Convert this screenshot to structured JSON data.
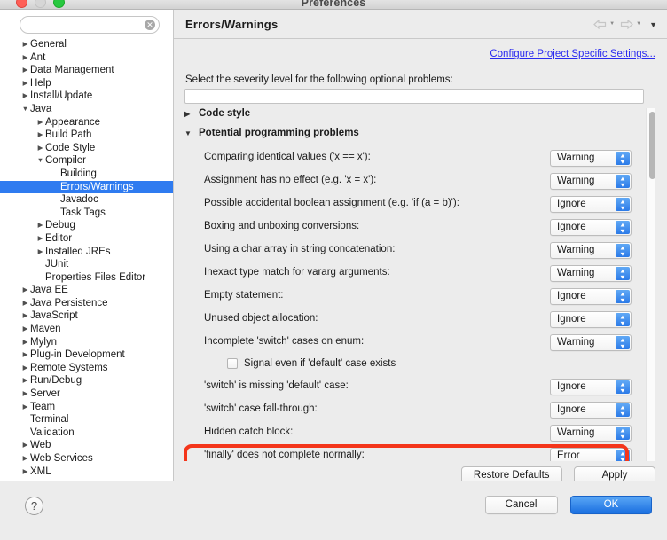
{
  "window": {
    "title": "Preferences",
    "traffic_lights": [
      "close",
      "minimize",
      "zoom"
    ]
  },
  "sidebar": {
    "search": {
      "value": "",
      "placeholder": ""
    },
    "clear_icon": "clear-icon",
    "items": [
      {
        "label": "General",
        "depth": 0,
        "twisty": "right",
        "selected": false
      },
      {
        "label": "Ant",
        "depth": 0,
        "twisty": "right",
        "selected": false
      },
      {
        "label": "Data Management",
        "depth": 0,
        "twisty": "right",
        "selected": false
      },
      {
        "label": "Help",
        "depth": 0,
        "twisty": "right",
        "selected": false
      },
      {
        "label": "Install/Update",
        "depth": 0,
        "twisty": "right",
        "selected": false
      },
      {
        "label": "Java",
        "depth": 0,
        "twisty": "down",
        "selected": false
      },
      {
        "label": "Appearance",
        "depth": 1,
        "twisty": "right",
        "selected": false
      },
      {
        "label": "Build Path",
        "depth": 1,
        "twisty": "right",
        "selected": false
      },
      {
        "label": "Code Style",
        "depth": 1,
        "twisty": "right",
        "selected": false
      },
      {
        "label": "Compiler",
        "depth": 1,
        "twisty": "down",
        "selected": false
      },
      {
        "label": "Building",
        "depth": 2,
        "twisty": "none",
        "selected": false
      },
      {
        "label": "Errors/Warnings",
        "depth": 2,
        "twisty": "none",
        "selected": true
      },
      {
        "label": "Javadoc",
        "depth": 2,
        "twisty": "none",
        "selected": false
      },
      {
        "label": "Task Tags",
        "depth": 2,
        "twisty": "none",
        "selected": false
      },
      {
        "label": "Debug",
        "depth": 1,
        "twisty": "right",
        "selected": false
      },
      {
        "label": "Editor",
        "depth": 1,
        "twisty": "right",
        "selected": false
      },
      {
        "label": "Installed JREs",
        "depth": 1,
        "twisty": "right",
        "selected": false
      },
      {
        "label": "JUnit",
        "depth": 1,
        "twisty": "none",
        "selected": false
      },
      {
        "label": "Properties Files Editor",
        "depth": 1,
        "twisty": "none",
        "selected": false
      },
      {
        "label": "Java EE",
        "depth": 0,
        "twisty": "right",
        "selected": false
      },
      {
        "label": "Java Persistence",
        "depth": 0,
        "twisty": "right",
        "selected": false
      },
      {
        "label": "JavaScript",
        "depth": 0,
        "twisty": "right",
        "selected": false
      },
      {
        "label": "Maven",
        "depth": 0,
        "twisty": "right",
        "selected": false
      },
      {
        "label": "Mylyn",
        "depth": 0,
        "twisty": "right",
        "selected": false
      },
      {
        "label": "Plug-in Development",
        "depth": 0,
        "twisty": "right",
        "selected": false
      },
      {
        "label": "Remote Systems",
        "depth": 0,
        "twisty": "right",
        "selected": false
      },
      {
        "label": "Run/Debug",
        "depth": 0,
        "twisty": "right",
        "selected": false
      },
      {
        "label": "Server",
        "depth": 0,
        "twisty": "right",
        "selected": false
      },
      {
        "label": "Team",
        "depth": 0,
        "twisty": "right",
        "selected": false
      },
      {
        "label": "Terminal",
        "depth": 0,
        "twisty": "none",
        "selected": false
      },
      {
        "label": "Validation",
        "depth": 0,
        "twisty": "none",
        "selected": false
      },
      {
        "label": "Web",
        "depth": 0,
        "twisty": "right",
        "selected": false
      },
      {
        "label": "Web Services",
        "depth": 0,
        "twisty": "right",
        "selected": false
      },
      {
        "label": "XML",
        "depth": 0,
        "twisty": "right",
        "selected": false
      }
    ]
  },
  "panel": {
    "title": "Errors/Warnings",
    "nav": {
      "back_icon": "back-arrow-icon",
      "forward_icon": "forward-arrow-icon",
      "menu_icon": "chevron-down-icon"
    },
    "configure_link": "Configure Project Specific Settings...",
    "severity_label": "Select the severity level for the following optional problems:",
    "filter": {
      "value": "",
      "placeholder": ""
    },
    "groups": [
      {
        "label": "Code style",
        "expanded": false
      },
      {
        "label": "Potential programming problems",
        "expanded": true
      }
    ],
    "options": [
      {
        "label": "Comparing identical values ('x == x'):",
        "value": "Warning",
        "highlighted": false
      },
      {
        "label": "Assignment has no effect (e.g. 'x = x'):",
        "value": "Warning",
        "highlighted": false
      },
      {
        "label": "Possible accidental boolean assignment (e.g. 'if (a = b)'):",
        "value": "Ignore",
        "highlighted": false
      },
      {
        "label": "Boxing and unboxing conversions:",
        "value": "Ignore",
        "highlighted": false
      },
      {
        "label": "Using a char array in string concatenation:",
        "value": "Warning",
        "highlighted": false
      },
      {
        "label": "Inexact type match for vararg arguments:",
        "value": "Warning",
        "highlighted": false
      },
      {
        "label": "Empty statement:",
        "value": "Ignore",
        "highlighted": false
      },
      {
        "label": "Unused object allocation:",
        "value": "Ignore",
        "highlighted": false
      },
      {
        "label": "Incomplete 'switch' cases on enum:",
        "value": "Warning",
        "highlighted": false
      }
    ],
    "checkbox": {
      "label": "Signal even if 'default' case exists",
      "checked": false
    },
    "options2": [
      {
        "label": "'switch' is missing 'default' case:",
        "value": "Ignore",
        "highlighted": false
      },
      {
        "label": "'switch' case fall-through:",
        "value": "Ignore",
        "highlighted": false
      },
      {
        "label": "Hidden catch block:",
        "value": "Warning",
        "highlighted": false
      },
      {
        "label": "'finally' does not complete normally:",
        "value": "Error",
        "highlighted": true
      }
    ],
    "restore_defaults_label": "Restore Defaults",
    "apply_label": "Apply"
  },
  "footer": {
    "help_icon": "question-mark-icon",
    "cancel_label": "Cancel",
    "ok_label": "OK"
  },
  "colors": {
    "selection_blue": "#2f7bf0",
    "link_blue": "#2a2af0",
    "annotation_red": "#f4351a",
    "ok_button_blue": "#1a6fe0"
  }
}
